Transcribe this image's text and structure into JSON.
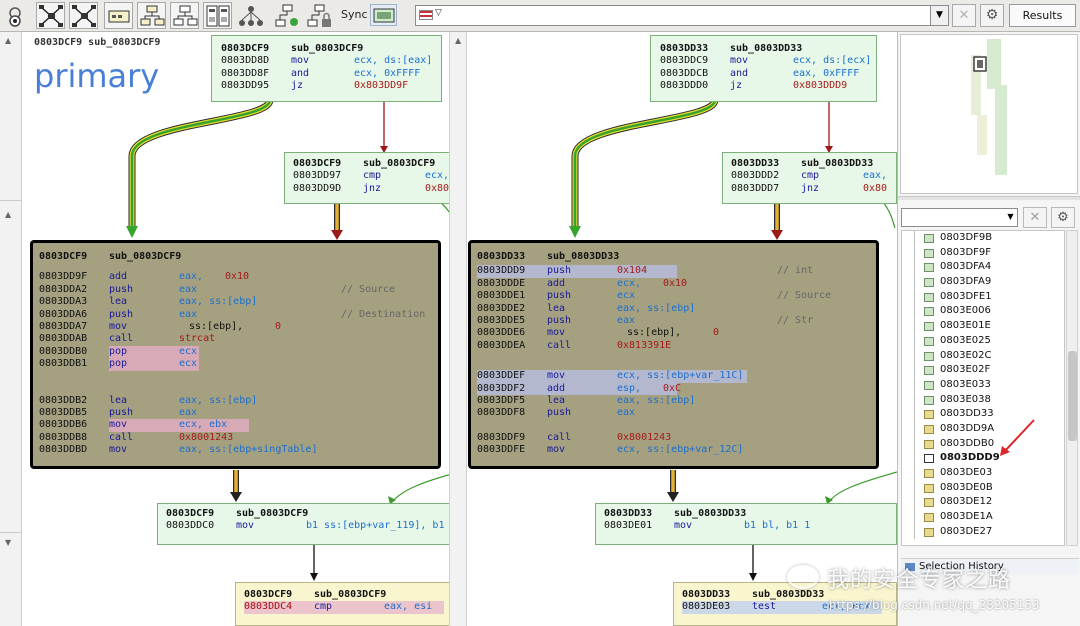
{
  "toolbar": {
    "sync_label": "Sync",
    "results_label": "Results",
    "address_value": "",
    "tools": [
      "zoom-icon",
      "layout-hierarchical-icon",
      "layout-circular-icon",
      "graph-icon",
      "tree-icon",
      "node-tree-icon",
      "split-view-icon",
      "network-icon",
      "flow-icon",
      "locked-flow-icon"
    ]
  },
  "left": {
    "func_label": "0803DCF9 sub_0803DCF9",
    "title": "primary",
    "top_block": {
      "header_addr": "0803DCF9",
      "header_name": "sub_0803DCF9",
      "rows": [
        {
          "addr": "0803DD8D",
          "mn": "mov",
          "op": "ecx, ds:[eax]"
        },
        {
          "addr": "0803DD8F",
          "mn": "and",
          "op": "ecx, 0xFFFF"
        },
        {
          "addr": "0803DD95",
          "mn": "jz",
          "op": "0x803DD9F"
        }
      ]
    },
    "mid_block": {
      "header_addr": "0803DCF9",
      "header_name": "sub_0803DCF9",
      "rows": [
        {
          "addr": "0803DD97",
          "mn": "cmp",
          "op": "ecx,"
        },
        {
          "addr": "0803DD9D",
          "mn": "jnz",
          "op": "0x80"
        }
      ]
    },
    "big_block": {
      "header_addr": "0803DCF9",
      "header_name": "sub_0803DCF9",
      "rows": [
        {
          "addr": "0803DD9F",
          "mn": "add",
          "op": "eax,",
          "op2": "0x10",
          "cm": ""
        },
        {
          "addr": "0803DDA2",
          "mn": "push",
          "op": "eax",
          "cm": "// Source"
        },
        {
          "addr": "0803DDA3",
          "mn": "lea",
          "op": "eax, ss:[ebp]",
          "cm": ""
        },
        {
          "addr": "0803DDA6",
          "mn": "push",
          "op": "eax",
          "cm": "// Destination"
        },
        {
          "addr": "0803DDA7",
          "mn": "mov",
          "op": "ss:[ebp],",
          "op2": "0",
          "cm": ""
        },
        {
          "addr": "0803DDAB",
          "mn": "call",
          "op": "strcat",
          "cm": ""
        },
        {
          "addr": "0803DDB0",
          "mn": "pop",
          "op": "ecx",
          "cm": ""
        },
        {
          "addr": "0803DDB1",
          "mn": "pop",
          "op": "ecx",
          "cm": ""
        },
        {
          "addr": "0803DDB2",
          "mn": "lea",
          "op": "eax, ss:[ebp]",
          "cm": ""
        },
        {
          "addr": "0803DDB5",
          "mn": "push",
          "op": "eax",
          "cm": ""
        },
        {
          "addr": "0803DDB6",
          "mn": "mov",
          "op": "ecx, ebx",
          "cm": ""
        },
        {
          "addr": "0803DDB8",
          "mn": "call",
          "op": "0x8001243",
          "cm": ""
        },
        {
          "addr": "0803DDBD",
          "mn": "mov",
          "op": "eax, ss:[ebp+singTable]",
          "cm": ""
        }
      ]
    },
    "lower_block": {
      "header_addr": "0803DCF9",
      "header_name": "sub_0803DCF9",
      "rows": [
        {
          "addr": "0803DDC0",
          "mn": "mov",
          "op": "b1 ss:[ebp+var_119], b1"
        }
      ]
    },
    "bottom_block": {
      "header_addr": "0803DCF9",
      "header_name": "sub_0803DCF9",
      "rows": [
        {
          "addr": "0803DDC4",
          "mn": "cmp",
          "op": "eax, esi"
        }
      ]
    }
  },
  "right": {
    "top_block": {
      "header_addr": "0803DD33",
      "header_name": "sub_0803DD33",
      "rows": [
        {
          "addr": "0803DDC9",
          "mn": "mov",
          "op": "ecx, ds:[ecx]"
        },
        {
          "addr": "0803DDCB",
          "mn": "and",
          "op": "eax, 0xFFFF"
        },
        {
          "addr": "0803DDD0",
          "mn": "jz",
          "op": "0x803DDD9"
        }
      ]
    },
    "mid_block": {
      "header_addr": "0803DD33",
      "header_name": "sub_0803DD33",
      "rows": [
        {
          "addr": "0803DDD2",
          "mn": "cmp",
          "op": "eax,"
        },
        {
          "addr": "0803DDD7",
          "mn": "jnz",
          "op": "0x80"
        }
      ]
    },
    "big_block": {
      "header_addr": "0803DD33",
      "header_name": "sub_0803DD33",
      "rows": [
        {
          "addr": "0803DDD9",
          "mn": "push",
          "op": "0x104",
          "op2": "",
          "cm": "// int"
        },
        {
          "addr": "0803DDDE",
          "mn": "add",
          "op": "ecx,",
          "op2": "0x10",
          "cm": ""
        },
        {
          "addr": "0803DDE1",
          "mn": "push",
          "op": "ecx",
          "cm": "// Source"
        },
        {
          "addr": "0803DDE2",
          "mn": "lea",
          "op": "eax, ss:[ebp]",
          "cm": ""
        },
        {
          "addr": "0803DDE5",
          "mn": "push",
          "op": "eax",
          "cm": "// Str"
        },
        {
          "addr": "0803DDE6",
          "mn": "mov",
          "op": "ss:[ebp],",
          "op2": "0",
          "cm": ""
        },
        {
          "addr": "0803DDEA",
          "mn": "call",
          "op": "0x813391E",
          "cm": ""
        },
        {
          "addr": "0803DDEF",
          "mn": "mov",
          "op": "ecx, ss:[ebp+var_11C]",
          "cm": ""
        },
        {
          "addr": "0803DDF2",
          "mn": "add",
          "op": "esp,",
          "op2": "0xC",
          "cm": ""
        },
        {
          "addr": "0803DDF5",
          "mn": "lea",
          "op": "eax, ss:[ebp]",
          "cm": ""
        },
        {
          "addr": "0803DDF8",
          "mn": "push",
          "op": "eax",
          "cm": ""
        },
        {
          "addr": "0803DDF9",
          "mn": "call",
          "op": "0x8001243",
          "cm": ""
        },
        {
          "addr": "0803DDFE",
          "mn": "mov",
          "op": "ecx, ss:[ebp+var_12C]",
          "cm": ""
        }
      ]
    },
    "lower_block": {
      "header_addr": "0803DD33",
      "header_name": "sub_0803DD33",
      "rows": [
        {
          "addr": "0803DE01",
          "mn": "mov",
          "op": "b1 bl, b1 1"
        }
      ]
    },
    "bottom_block": {
      "header_addr": "0803DD33",
      "header_name": "sub_0803DD33",
      "rows": [
        {
          "addr": "0803DE03",
          "mn": "test",
          "op": "ecx, ecx"
        }
      ]
    }
  },
  "side": {
    "blocks": [
      {
        "label": "0803DF9B",
        "color": "green"
      },
      {
        "label": "0803DF9F",
        "color": "green"
      },
      {
        "label": "0803DFA4",
        "color": "green"
      },
      {
        "label": "0803DFA9",
        "color": "green"
      },
      {
        "label": "0803DFE1",
        "color": "green"
      },
      {
        "label": "0803E006",
        "color": "green"
      },
      {
        "label": "0803E01E",
        "color": "green"
      },
      {
        "label": "0803E025",
        "color": "green"
      },
      {
        "label": "0803E02C",
        "color": "green"
      },
      {
        "label": "0803E02F",
        "color": "green"
      },
      {
        "label": "0803E033",
        "color": "green"
      },
      {
        "label": "0803E038",
        "color": "green"
      },
      {
        "label": "0803DD33",
        "color": "yellow"
      },
      {
        "label": "0803DD9A",
        "color": "yellow"
      },
      {
        "label": "0803DDB0",
        "color": "yellow"
      },
      {
        "label": "0803DDD9",
        "color": "selected"
      },
      {
        "label": "0803DE03",
        "color": "yellow"
      },
      {
        "label": "0803DE0B",
        "color": "yellow"
      },
      {
        "label": "0803DE12",
        "color": "yellow"
      },
      {
        "label": "0803DE1A",
        "color": "yellow"
      },
      {
        "label": "0803DE27",
        "color": "yellow"
      }
    ],
    "selection_history": "Selection History"
  },
  "watermark": {
    "line1": "我的安全专家之路",
    "line2": "https://blog.csdn.net/qq_28205153"
  },
  "colors": {
    "accent": "#4a7fd8",
    "green_block": "#e8f8e8",
    "big_block": "#a4a080",
    "edge_green": "#3b9a2c",
    "edge_red": "#9a1a1a",
    "arrow_red": "#e0242a"
  }
}
